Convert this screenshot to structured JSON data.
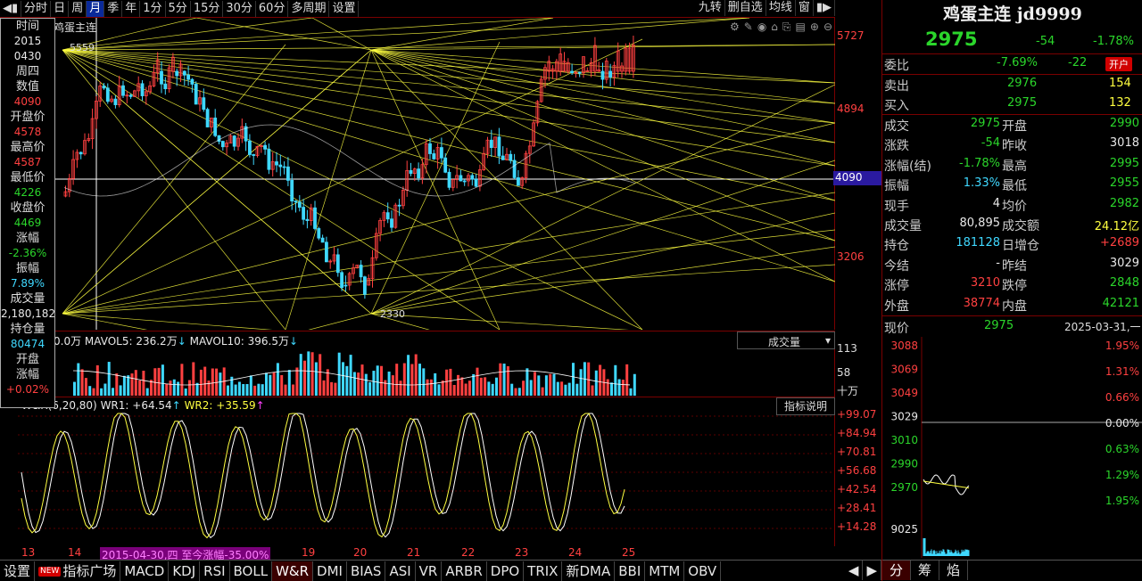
{
  "toolbar": {
    "items": [
      "分时",
      "日",
      "周",
      "月",
      "季",
      "年",
      "1分",
      "5分",
      "15分",
      "30分",
      "60分",
      "多周期",
      "设置"
    ],
    "active_index": 3,
    "right_items": [
      "九转",
      "删自选",
      "均线",
      "窗"
    ]
  },
  "chart": {
    "title": "鸡蛋主连",
    "price_high_label": "5559",
    "price_low_label": "2330",
    "yaxis": [
      "5727",
      "4894",
      "4090",
      "3206"
    ],
    "crosshair_value": "4090",
    "chart_icons": [
      "settings-icon",
      "pencil-icon",
      "eye-icon",
      "basket-icon",
      "copy-icon",
      "layout-icon",
      "zoom-in-icon",
      "zoom-out-icon"
    ]
  },
  "infopanel": [
    {
      "label": "时间",
      "value": "2015"
    },
    {
      "label": "",
      "value": "0430"
    },
    {
      "label": "周四",
      "value": ""
    },
    {
      "label": "数值",
      "value": "4090"
    },
    {
      "label": "开盘价",
      "value": "4578"
    },
    {
      "label": "最高价",
      "value": "4587"
    },
    {
      "label": "最低价",
      "value": "4226"
    },
    {
      "label": "收盘价",
      "value": "4469"
    },
    {
      "label": "涨幅",
      "value": "-2.36%"
    },
    {
      "label": "振幅",
      "value": "7.89%"
    },
    {
      "label": "成交量",
      "value": "2,180,182"
    },
    {
      "label": "持仓量",
      "value": "80474"
    },
    {
      "label": "开盘",
      "value": ""
    },
    {
      "label": "涨幅",
      "value": "+0.02%"
    }
  ],
  "volume": {
    "legend_prefix": "0.0万",
    "mavol5": "MAVOL5: 236.2万",
    "mavol10": "MAVOL10: 396.5万",
    "selector": "成交量",
    "yaxis": [
      "113",
      "58",
      "十万"
    ]
  },
  "wr": {
    "legend": "W&R(6,20,80)",
    "wr1": "WR1: +64.54",
    "wr2": "WR2: +35.59",
    "help_button": "指标说明",
    "yaxis": [
      "+99.07",
      "+84.94",
      "+70.81",
      "+56.68",
      "+42.54",
      "+28.41",
      "+14.28"
    ],
    "date_labels": [
      "13",
      "14",
      "19",
      "20",
      "21",
      "22",
      "23",
      "24",
      "25"
    ],
    "selection_label": "2015-04-30,四 至今涨幅-35.00%"
  },
  "quote": {
    "name": "鸡蛋主连 jd9999",
    "price": "2975",
    "change": "-54",
    "change_pct": "-1.78%",
    "weibi_label": "委比",
    "weibi": "-7.69%",
    "weicha": "-22",
    "open_badge": "开户",
    "sell_label": "卖出",
    "sell_price": "2976",
    "sell_vol": "154",
    "buy_label": "买入",
    "buy_price": "2975",
    "buy_vol": "132",
    "rows": [
      {
        "l1": "成交",
        "v1": "2975",
        "l2": "开盘",
        "v2": "2990"
      },
      {
        "l1": "涨跌",
        "v1": "-54",
        "l2": "昨收",
        "v2": "3018"
      },
      {
        "l1": "涨幅(结)",
        "v1": "-1.78%",
        "l2": "最高",
        "v2": "2995"
      },
      {
        "l1": "振幅",
        "v1": "1.33%",
        "l2": "最低",
        "v2": "2955"
      },
      {
        "l1": "现手",
        "v1": "4",
        "l2": "均价",
        "v2": "2982"
      },
      {
        "l1": "成交量",
        "v1": "80,895",
        "l2": "成交额",
        "v2": "24.12亿"
      },
      {
        "l1": "持仓",
        "v1": "181128",
        "l2": "日增仓",
        "v2": "+2689"
      },
      {
        "l1": "今结",
        "v1": "-",
        "l2": "昨结",
        "v2": "3029"
      },
      {
        "l1": "涨停",
        "v1": "3210",
        "l2": "跌停",
        "v2": "2848"
      },
      {
        "l1": "外盘",
        "v1": "38774",
        "l2": "内盘",
        "v2": "42121"
      }
    ],
    "current_label": "现价",
    "current_value": "2975",
    "date": "2025-03-31,一"
  },
  "minichart": {
    "left_axis": [
      "3088",
      "3069",
      "3049",
      "3029",
      "3010",
      "2990",
      "2970",
      "9025"
    ],
    "right_axis": [
      "1.95%",
      "1.31%",
      "0.66%",
      "0.00%",
      "0.63%",
      "1.29%",
      "1.95%"
    ]
  },
  "right_tabs": [
    "分",
    "筹",
    "焰"
  ],
  "bottom_tabs": [
    "设置",
    "指标广场",
    "MACD",
    "KDJ",
    "RSI",
    "BOLL",
    "W&R",
    "DMI",
    "BIAS",
    "ASI",
    "VR",
    "ARBR",
    "DPO",
    "TRIX",
    "新DMA",
    "BBI",
    "MTM",
    "OBV"
  ],
  "bottom_active": "W&R",
  "new_badge": "NEW",
  "colors": {
    "up": "#ff4040",
    "down": "#3fd8ff",
    "gann": "#ffff40",
    "bg": "#000000",
    "frame": "#7a0000"
  }
}
